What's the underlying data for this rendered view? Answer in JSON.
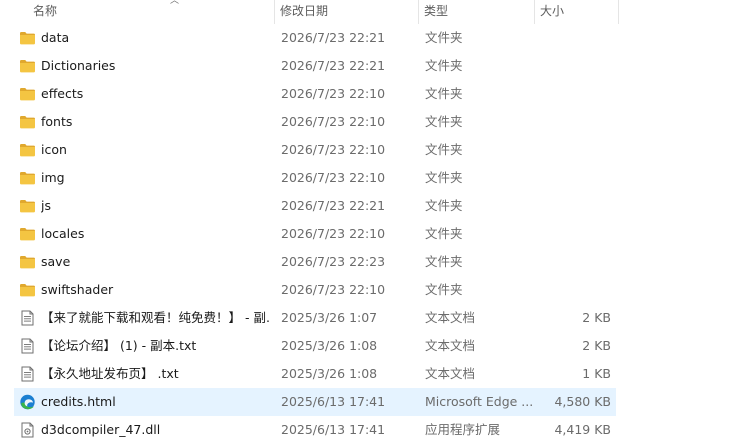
{
  "columns": {
    "name": "名称",
    "date": "修改日期",
    "type": "类型",
    "size": "大小"
  },
  "sort_icon": "chevron-up-icon",
  "colors": {
    "folder": "#f4c542",
    "folder_dark": "#e0a82e",
    "selected_row": "#e5f3ff",
    "edge_blue": "#1b7fd1",
    "edge_green": "#39b54a"
  },
  "rows": [
    {
      "name": "data",
      "date": "2026/7/23 22:21",
      "type": "文件夹",
      "size": "",
      "icon": "folder-icon"
    },
    {
      "name": "Dictionaries",
      "date": "2026/7/23 22:21",
      "type": "文件夹",
      "size": "",
      "icon": "folder-icon"
    },
    {
      "name": "effects",
      "date": "2026/7/23 22:10",
      "type": "文件夹",
      "size": "",
      "icon": "folder-icon"
    },
    {
      "name": "fonts",
      "date": "2026/7/23 22:10",
      "type": "文件夹",
      "size": "",
      "icon": "folder-icon"
    },
    {
      "name": "icon",
      "date": "2026/7/23 22:10",
      "type": "文件夹",
      "size": "",
      "icon": "folder-icon"
    },
    {
      "name": "img",
      "date": "2026/7/23 22:10",
      "type": "文件夹",
      "size": "",
      "icon": "folder-icon"
    },
    {
      "name": "js",
      "date": "2026/7/23 22:21",
      "type": "文件夹",
      "size": "",
      "icon": "folder-icon"
    },
    {
      "name": "locales",
      "date": "2026/7/23 22:10",
      "type": "文件夹",
      "size": "",
      "icon": "folder-icon"
    },
    {
      "name": "save",
      "date": "2026/7/23 22:23",
      "type": "文件夹",
      "size": "",
      "icon": "folder-icon"
    },
    {
      "name": "swiftshader",
      "date": "2026/7/23 22:10",
      "type": "文件夹",
      "size": "",
      "icon": "folder-icon"
    },
    {
      "name": "【来了就能下载和观看！纯免费！】 - 副...",
      "date": "2025/3/26 1:07",
      "type": "文本文档",
      "size": "2 KB",
      "icon": "text-file-icon"
    },
    {
      "name": "【论坛介绍】 (1) - 副本.txt",
      "date": "2025/3/26 1:08",
      "type": "文本文档",
      "size": "2 KB",
      "icon": "text-file-icon"
    },
    {
      "name": "【永久地址发布页】 .txt",
      "date": "2025/3/26 1:08",
      "type": "文本文档",
      "size": "1 KB",
      "icon": "text-file-icon"
    },
    {
      "name": "credits.html",
      "date": "2025/6/13 17:41",
      "type": "Microsoft Edge ...",
      "size": "4,580 KB",
      "icon": "edge-icon",
      "selected": true
    },
    {
      "name": "d3dcompiler_47.dll",
      "date": "2025/6/13 17:41",
      "type": "应用程序扩展",
      "size": "4,419 KB",
      "icon": "dll-file-icon"
    }
  ]
}
